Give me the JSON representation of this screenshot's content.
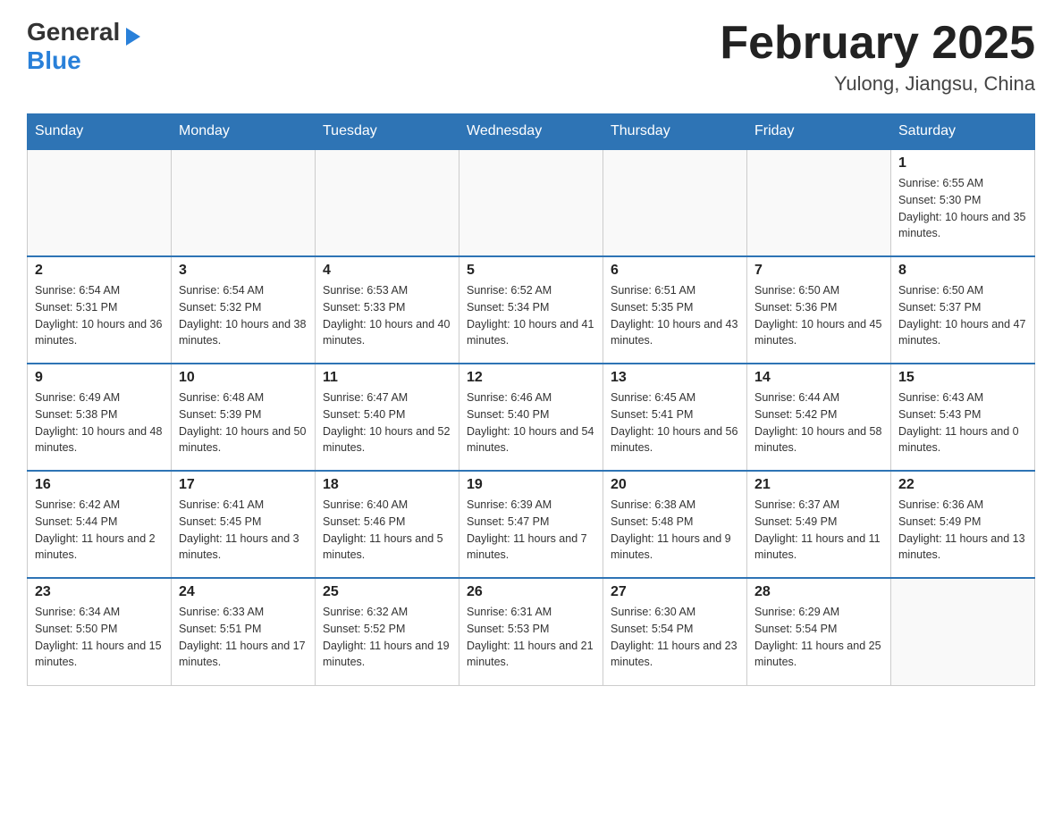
{
  "header": {
    "logo_general": "General",
    "logo_blue": "Blue",
    "month_title": "February 2025",
    "location": "Yulong, Jiangsu, China"
  },
  "days_of_week": [
    "Sunday",
    "Monday",
    "Tuesday",
    "Wednesday",
    "Thursday",
    "Friday",
    "Saturday"
  ],
  "weeks": [
    [
      {
        "day": "",
        "info": ""
      },
      {
        "day": "",
        "info": ""
      },
      {
        "day": "",
        "info": ""
      },
      {
        "day": "",
        "info": ""
      },
      {
        "day": "",
        "info": ""
      },
      {
        "day": "",
        "info": ""
      },
      {
        "day": "1",
        "info": "Sunrise: 6:55 AM\nSunset: 5:30 PM\nDaylight: 10 hours and 35 minutes."
      }
    ],
    [
      {
        "day": "2",
        "info": "Sunrise: 6:54 AM\nSunset: 5:31 PM\nDaylight: 10 hours and 36 minutes."
      },
      {
        "day": "3",
        "info": "Sunrise: 6:54 AM\nSunset: 5:32 PM\nDaylight: 10 hours and 38 minutes."
      },
      {
        "day": "4",
        "info": "Sunrise: 6:53 AM\nSunset: 5:33 PM\nDaylight: 10 hours and 40 minutes."
      },
      {
        "day": "5",
        "info": "Sunrise: 6:52 AM\nSunset: 5:34 PM\nDaylight: 10 hours and 41 minutes."
      },
      {
        "day": "6",
        "info": "Sunrise: 6:51 AM\nSunset: 5:35 PM\nDaylight: 10 hours and 43 minutes."
      },
      {
        "day": "7",
        "info": "Sunrise: 6:50 AM\nSunset: 5:36 PM\nDaylight: 10 hours and 45 minutes."
      },
      {
        "day": "8",
        "info": "Sunrise: 6:50 AM\nSunset: 5:37 PM\nDaylight: 10 hours and 47 minutes."
      }
    ],
    [
      {
        "day": "9",
        "info": "Sunrise: 6:49 AM\nSunset: 5:38 PM\nDaylight: 10 hours and 48 minutes."
      },
      {
        "day": "10",
        "info": "Sunrise: 6:48 AM\nSunset: 5:39 PM\nDaylight: 10 hours and 50 minutes."
      },
      {
        "day": "11",
        "info": "Sunrise: 6:47 AM\nSunset: 5:40 PM\nDaylight: 10 hours and 52 minutes."
      },
      {
        "day": "12",
        "info": "Sunrise: 6:46 AM\nSunset: 5:40 PM\nDaylight: 10 hours and 54 minutes."
      },
      {
        "day": "13",
        "info": "Sunrise: 6:45 AM\nSunset: 5:41 PM\nDaylight: 10 hours and 56 minutes."
      },
      {
        "day": "14",
        "info": "Sunrise: 6:44 AM\nSunset: 5:42 PM\nDaylight: 10 hours and 58 minutes."
      },
      {
        "day": "15",
        "info": "Sunrise: 6:43 AM\nSunset: 5:43 PM\nDaylight: 11 hours and 0 minutes."
      }
    ],
    [
      {
        "day": "16",
        "info": "Sunrise: 6:42 AM\nSunset: 5:44 PM\nDaylight: 11 hours and 2 minutes."
      },
      {
        "day": "17",
        "info": "Sunrise: 6:41 AM\nSunset: 5:45 PM\nDaylight: 11 hours and 3 minutes."
      },
      {
        "day": "18",
        "info": "Sunrise: 6:40 AM\nSunset: 5:46 PM\nDaylight: 11 hours and 5 minutes."
      },
      {
        "day": "19",
        "info": "Sunrise: 6:39 AM\nSunset: 5:47 PM\nDaylight: 11 hours and 7 minutes."
      },
      {
        "day": "20",
        "info": "Sunrise: 6:38 AM\nSunset: 5:48 PM\nDaylight: 11 hours and 9 minutes."
      },
      {
        "day": "21",
        "info": "Sunrise: 6:37 AM\nSunset: 5:49 PM\nDaylight: 11 hours and 11 minutes."
      },
      {
        "day": "22",
        "info": "Sunrise: 6:36 AM\nSunset: 5:49 PM\nDaylight: 11 hours and 13 minutes."
      }
    ],
    [
      {
        "day": "23",
        "info": "Sunrise: 6:34 AM\nSunset: 5:50 PM\nDaylight: 11 hours and 15 minutes."
      },
      {
        "day": "24",
        "info": "Sunrise: 6:33 AM\nSunset: 5:51 PM\nDaylight: 11 hours and 17 minutes."
      },
      {
        "day": "25",
        "info": "Sunrise: 6:32 AM\nSunset: 5:52 PM\nDaylight: 11 hours and 19 minutes."
      },
      {
        "day": "26",
        "info": "Sunrise: 6:31 AM\nSunset: 5:53 PM\nDaylight: 11 hours and 21 minutes."
      },
      {
        "day": "27",
        "info": "Sunrise: 6:30 AM\nSunset: 5:54 PM\nDaylight: 11 hours and 23 minutes."
      },
      {
        "day": "28",
        "info": "Sunrise: 6:29 AM\nSunset: 5:54 PM\nDaylight: 11 hours and 25 minutes."
      },
      {
        "day": "",
        "info": ""
      }
    ]
  ]
}
